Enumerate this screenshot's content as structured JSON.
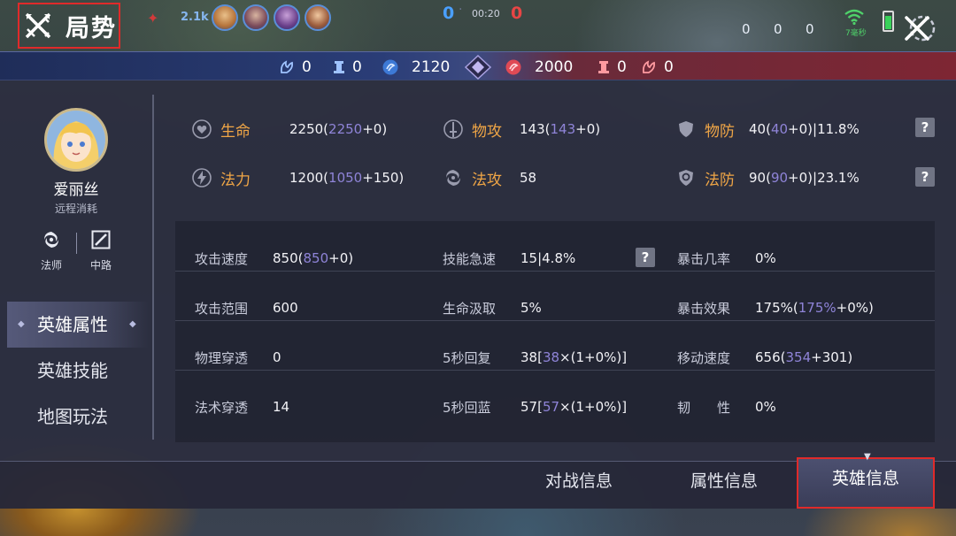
{
  "header": {
    "title": "局势",
    "kills_count": "2.1k",
    "score_blue": "0",
    "score_red": "0",
    "timer": "00:20",
    "right_stats": [
      "0",
      "0",
      "0"
    ],
    "ping": "7毫秒"
  },
  "resources": {
    "blue": [
      {
        "icon": "dragon-icon",
        "value": "0"
      },
      {
        "icon": "tower-icon",
        "value": "0"
      },
      {
        "icon": "gold-icon",
        "value": "2120"
      }
    ],
    "red": [
      {
        "icon": "gold-icon",
        "value": "2000"
      },
      {
        "icon": "tower-icon",
        "value": "0"
      },
      {
        "icon": "dragon-icon",
        "value": "0"
      }
    ]
  },
  "hero": {
    "name": "爱丽丝",
    "role": "远程消耗",
    "tags": [
      {
        "icon": "mage-icon",
        "label": "法师"
      },
      {
        "icon": "mid-lane-icon",
        "label": "中路"
      }
    ]
  },
  "side_nav": [
    {
      "label": "英雄属性",
      "active": true
    },
    {
      "label": "英雄技能",
      "active": false
    },
    {
      "label": "地图玩法",
      "active": false
    }
  ],
  "top_stats": {
    "hp": {
      "name": "生命",
      "base": "2250(",
      "hl": "2250",
      "rest": "+0)"
    },
    "atk": {
      "name": "物攻",
      "base": "143(",
      "hl": "143",
      "rest": "+0)"
    },
    "def": {
      "name": "物防",
      "base": "40(",
      "hl": "40",
      "rest": "+0)|11.8%"
    },
    "mana": {
      "name": "法力",
      "base": "1200(",
      "hl": "1050",
      "rest": "+150)"
    },
    "ap": {
      "name": "法攻",
      "value": "58"
    },
    "mdef": {
      "name": "法防",
      "base": "90(",
      "hl": "90",
      "rest": "+0)|23.1%"
    },
    "help": "?"
  },
  "table": {
    "c1": [
      {
        "k": "攻击速度",
        "v1": "850(",
        "hl": "850",
        "v2": "+0)"
      },
      {
        "k": "攻击范围",
        "v1": "600",
        "hl": "",
        "v2": ""
      },
      {
        "k": "物理穿透",
        "v1": "0",
        "hl": "",
        "v2": ""
      },
      {
        "k": "法术穿透",
        "v1": "14",
        "hl": "",
        "v2": ""
      }
    ],
    "c2": [
      {
        "k": "技能急速",
        "v1": "15|4.8%",
        "hl": "",
        "v2": ""
      },
      {
        "k": "生命汲取",
        "v1": "5%",
        "hl": "",
        "v2": ""
      },
      {
        "k": "5秒回复",
        "v1": "38[",
        "hl": "38",
        "v2": "×(1+0%)]"
      },
      {
        "k": "5秒回蓝",
        "v1": "57[",
        "hl": "57",
        "v2": "×(1+0%)]"
      }
    ],
    "c3": [
      {
        "k": "暴击几率",
        "v1": "0%",
        "hl": "",
        "v2": ""
      },
      {
        "k": "暴击效果",
        "v1": "175%(",
        "hl": "175%",
        "v2": "+0%)"
      },
      {
        "k": "移动速度",
        "v1": "656(",
        "hl": "354",
        "v2": "+301)"
      },
      {
        "k": "韧　　性",
        "v1": "0%",
        "hl": "",
        "v2": ""
      }
    ]
  },
  "tabs": [
    {
      "label": "对战信息",
      "active": false
    },
    {
      "label": "属性信息",
      "active": false
    },
    {
      "label": "英雄信息",
      "active": true
    }
  ]
}
